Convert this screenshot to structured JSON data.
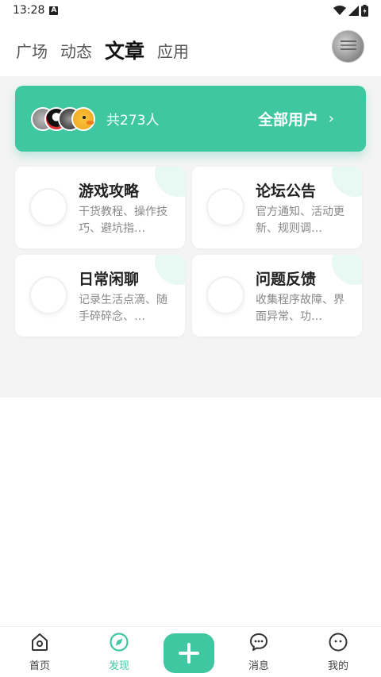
{
  "status_bar": {
    "time": "13:28",
    "notification_icon": "A"
  },
  "top_nav": {
    "tabs": [
      {
        "label": "广场"
      },
      {
        "label": "动态"
      },
      {
        "label": "文章",
        "active": true
      },
      {
        "label": "应用"
      }
    ]
  },
  "users_card": {
    "count_text": "共273人",
    "all_users_label": "全部用户",
    "chevron": "›"
  },
  "categories": [
    {
      "title": "游戏攻略",
      "desc": "干货教程、操作技巧、避坑指…"
    },
    {
      "title": "论坛公告",
      "desc": "官方通知、活动更新、规则调…"
    },
    {
      "title": "日常闲聊",
      "desc": "记录生活点滴、随手碎碎念、…"
    },
    {
      "title": "问题反馈",
      "desc": "收集程序故障、界面异常、功…"
    }
  ],
  "bottom_nav": {
    "items": [
      {
        "label": "首页",
        "icon": "home-icon"
      },
      {
        "label": "发现",
        "icon": "compass-icon",
        "active": true
      },
      {
        "label": "消息",
        "icon": "chat-icon"
      },
      {
        "label": "我的",
        "icon": "profile-icon"
      }
    ]
  },
  "colors": {
    "accent": "#3fc7a1",
    "background_gray": "#f4f4f4"
  }
}
